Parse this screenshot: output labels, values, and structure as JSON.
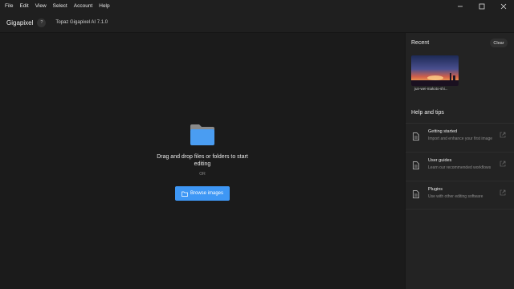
{
  "menubar": {
    "items": [
      "File",
      "Edit",
      "View",
      "Select",
      "Account",
      "Help"
    ]
  },
  "window_controls": [
    "minimize-icon",
    "maximize-icon",
    "close-icon"
  ],
  "appbar": {
    "app_name": "Gigapixel",
    "help_badge": "?",
    "version": "Topaz Gigapixel AI 7.1.0"
  },
  "main": {
    "drop_text": "Drag and drop files or folders to start editing",
    "or_text": "OR",
    "browse_label": "Browse images",
    "accent": "#3e97f5"
  },
  "recent": {
    "title": "Recent",
    "clear_label": "Clear",
    "items": [
      {
        "label": "jun-wei-makoto-shi..."
      }
    ]
  },
  "help": {
    "title": "Help and tips",
    "tips": [
      {
        "title": "Getting started",
        "desc": "Import and enhance your first image"
      },
      {
        "title": "User guides",
        "desc": "Learn our recommended workflows"
      },
      {
        "title": "Plugins",
        "desc": "Use with other editing software"
      }
    ]
  }
}
